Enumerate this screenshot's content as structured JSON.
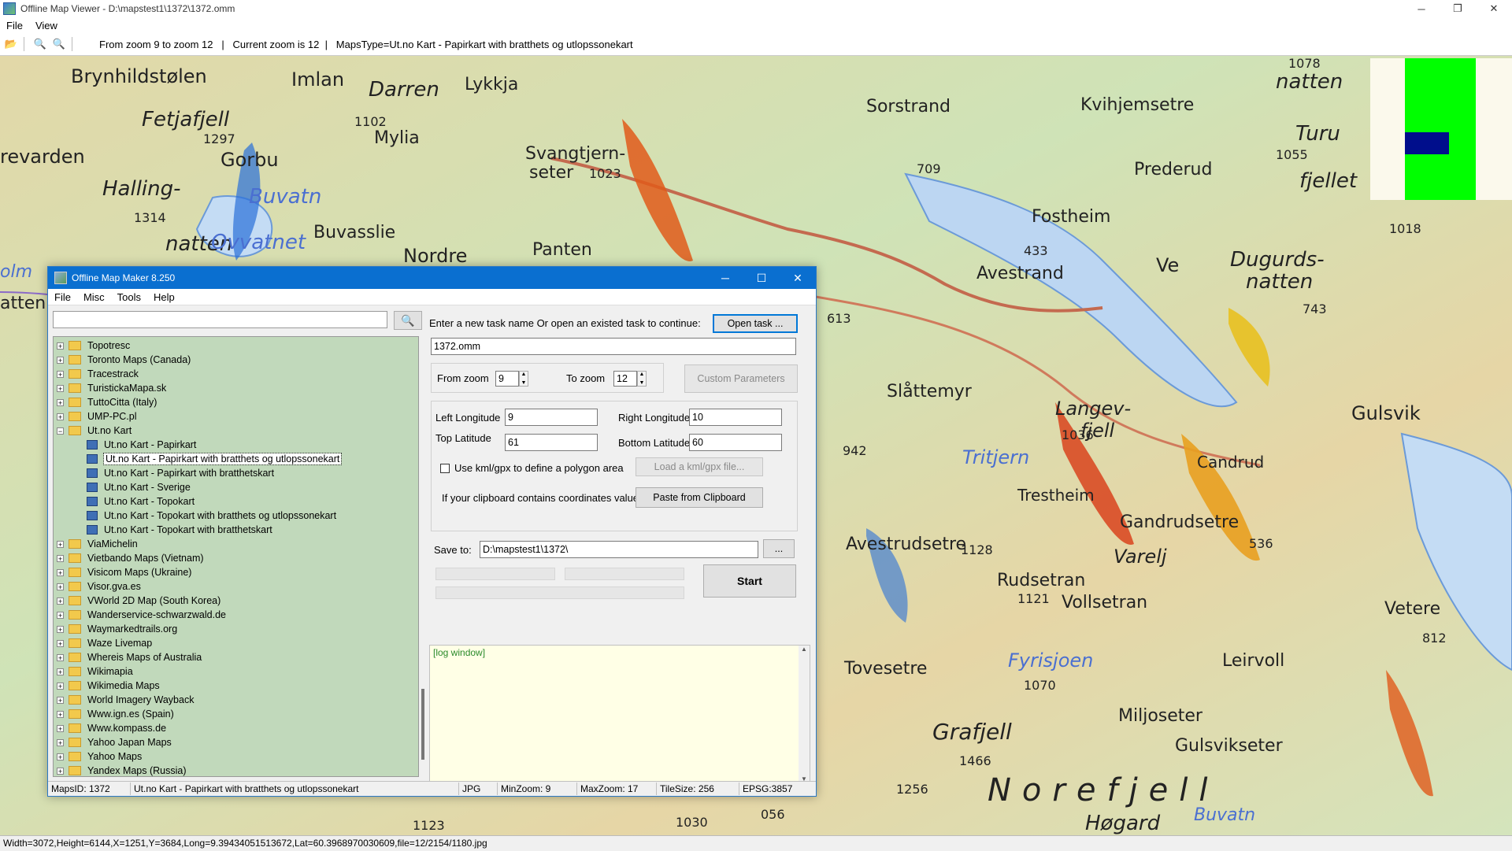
{
  "window": {
    "title": "Offline Map Viewer - D:\\mapstest1\\1372\\1372.omm",
    "min_symbol": "─",
    "max_symbol": "❐",
    "close_symbol": "✕"
  },
  "menu": {
    "file": "File",
    "view": "View"
  },
  "toolbar": {
    "open_icon": "📂",
    "zoom_out_icon": "🔍",
    "zoom_in_icon": "🔍",
    "status": "From zoom 9 to zoom 12   |   Current zoom is 12  |   MapsType=Ut.no Kart - Papirkart with bratthets og utlopssonekart"
  },
  "map": {
    "place_labels": [
      "Brynhildstølen",
      "Imlan",
      "Darren",
      "Lykkja",
      "Fetjafjell",
      "Mylia",
      "Gorbu",
      "Sorstrand",
      "Kvihjemsetre",
      "natten",
      "Turu",
      "fjellet",
      "Halling-",
      "natten",
      "Buvatn",
      "Buvasslie",
      "Nordre",
      "Panten",
      "Svangtjern-",
      "seter",
      "Prederud",
      "Fostheim",
      "Dugurds-",
      "natten",
      "Ve",
      "Avestrand",
      "Slåttemyr",
      "Langev-",
      "fjell",
      "Gulsvik",
      "Tritjern",
      "Trestheim",
      "Candrud",
      "Gandrudsetre",
      "Avestrudsetre",
      "Varelj",
      "Rudsetran",
      "Vollsetran",
      "Tovesetre",
      "Fyrisjoen",
      "Leirvoll",
      "Vetere",
      "Miljoseter",
      "Grafjell",
      "Gulsvikseter",
      "Norefjell",
      "Høgard",
      "Buvatn",
      "Ovvatnet",
      "revarden",
      "olm",
      "atten"
    ],
    "number_labels": [
      "1102",
      "1297",
      "1314",
      "1023",
      "709",
      "1055",
      "1018",
      "1078",
      "433",
      "743",
      "1036",
      "613",
      "942",
      "1128",
      "1121",
      "536",
      "812",
      "1070",
      "1466",
      "1256",
      "1123",
      "1030",
      "056"
    ]
  },
  "status_bar": {
    "text": "Width=3072,Height=6144,X=1251,Y=3684,Long=9.39434051513672,Lat=60.3968970030609,file=12/2154/1180.jpg"
  },
  "dialog": {
    "title": "Offline Map Maker 8.250",
    "min_symbol": "─",
    "max_symbol": "☐",
    "close_symbol": "✕",
    "menu": {
      "file": "File",
      "misc": "Misc",
      "tools": "Tools",
      "help": "Help"
    },
    "search": {
      "value": "",
      "icon": "🔍"
    },
    "tree": [
      {
        "label": "Topotresc",
        "type": "folder",
        "expanded": false
      },
      {
        "label": "Toronto Maps (Canada)",
        "type": "folder",
        "expanded": false
      },
      {
        "label": "Tracestrack",
        "type": "folder",
        "expanded": false
      },
      {
        "label": "TuristickaMapa.sk",
        "type": "folder",
        "expanded": false
      },
      {
        "label": "TuttoCitta (Italy)",
        "type": "folder",
        "expanded": false
      },
      {
        "label": "UMP-PC.pl",
        "type": "folder",
        "expanded": false
      },
      {
        "label": "Ut.no Kart",
        "type": "folder",
        "expanded": true
      },
      {
        "label": "Ut.no Kart - Papirkart",
        "type": "map"
      },
      {
        "label": "Ut.no Kart - Papirkart with bratthets og utlopssonekart",
        "type": "map",
        "selected": true
      },
      {
        "label": "Ut.no Kart - Papirkart with bratthetskart",
        "type": "map"
      },
      {
        "label": "Ut.no Kart - Sverige",
        "type": "map"
      },
      {
        "label": "Ut.no Kart - Topokart",
        "type": "map"
      },
      {
        "label": "Ut.no Kart - Topokart with bratthets og utlopssonekart",
        "type": "map"
      },
      {
        "label": "Ut.no Kart - Topokart with bratthetskart",
        "type": "map"
      },
      {
        "label": "ViaMichelin",
        "type": "folder",
        "expanded": false
      },
      {
        "label": "Vietbando Maps (Vietnam)",
        "type": "folder",
        "expanded": false
      },
      {
        "label": "Visicom Maps (Ukraine)",
        "type": "folder",
        "expanded": false
      },
      {
        "label": "Visor.gva.es",
        "type": "folder",
        "expanded": false
      },
      {
        "label": "VWorld 2D Map (South Korea)",
        "type": "folder",
        "expanded": false
      },
      {
        "label": "Wanderservice-schwarzwald.de",
        "type": "folder",
        "expanded": false
      },
      {
        "label": "Waymarkedtrails.org",
        "type": "folder",
        "expanded": false
      },
      {
        "label": "Waze Livemap",
        "type": "folder",
        "expanded": false
      },
      {
        "label": "Whereis Maps of Australia",
        "type": "folder",
        "expanded": false
      },
      {
        "label": "Wikimapia",
        "type": "folder",
        "expanded": false
      },
      {
        "label": "Wikimedia Maps",
        "type": "folder",
        "expanded": false
      },
      {
        "label": "World Imagery Wayback",
        "type": "folder",
        "expanded": false
      },
      {
        "label": "Www.ign.es (Spain)",
        "type": "folder",
        "expanded": false
      },
      {
        "label": "Www.kompass.de",
        "type": "folder",
        "expanded": false
      },
      {
        "label": "Yahoo Japan Maps",
        "type": "folder",
        "expanded": false
      },
      {
        "label": "Yahoo Maps",
        "type": "folder",
        "expanded": false
      },
      {
        "label": "Yandex Maps (Russia)",
        "type": "folder",
        "expanded": false
      }
    ],
    "task_prompt": "Enter a new task name Or open an existed task to continue:",
    "open_task_label": "Open task ...",
    "task_name": "1372.omm",
    "from_zoom_label": "From zoom",
    "from_zoom_value": "9",
    "to_zoom_label": "To zoom",
    "to_zoom_value": "12",
    "custom_params_label": "Custom Parameters",
    "left_lon_label": "Left Longitude",
    "left_lon_value": "9",
    "right_lon_label": "Right Longitude",
    "right_lon_value": "10",
    "top_lat_label": "Top Latitude",
    "top_lat_value": "61",
    "bottom_lat_label": "Bottom Latitude",
    "bottom_lat_value": "60",
    "kml_label": "Use kml/gpx to define a polygon area",
    "load_kml_label": "Load a kml/gpx file...",
    "clipboard_prompt": "If your clipboard contains coordinates values:",
    "paste_label": "Paste from Clipboard",
    "save_to_label": "Save to:",
    "save_to_value": "D:\\mapstest1\\1372\\",
    "browse_label": "...",
    "start_label": "Start",
    "log_text": "[log window]",
    "status": {
      "maps_id": "MapsID: 1372",
      "map_name": "Ut.no Kart - Papirkart with bratthets og utlopssonekart",
      "format": "JPG",
      "min_zoom": "MinZoom: 9",
      "max_zoom": "MaxZoom: 17",
      "tile_size": "TileSize: 256",
      "epsg": "EPSG:3857"
    }
  }
}
